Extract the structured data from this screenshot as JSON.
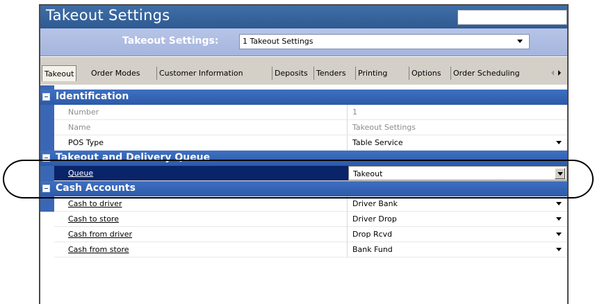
{
  "window": {
    "title": "Takeout Settings"
  },
  "selector": {
    "label": "Takeout Settings:",
    "value": "1 Takeout Settings"
  },
  "tabs": [
    "Takeout",
    "Order Modes",
    "Customer Information",
    "Deposits",
    "Tenders",
    "Printing",
    "Options",
    "Order Scheduling"
  ],
  "sections": {
    "identification": {
      "title": "Identification",
      "rows": [
        {
          "label": "Number",
          "value": "1"
        },
        {
          "label": "Name",
          "value": "Takeout Settings"
        },
        {
          "label": "POS Type",
          "value": "Table Service"
        }
      ]
    },
    "queue": {
      "title": "Takeout and Delivery Queue",
      "rows": [
        {
          "label": "Queue",
          "value": "Takeout"
        }
      ]
    },
    "cash": {
      "title": "Cash Accounts",
      "rows": [
        {
          "label": "Cash to driver",
          "value": "Driver Bank"
        },
        {
          "label": "Cash to store",
          "value": "Driver Drop"
        },
        {
          "label": "Cash from driver",
          "value": "Drop Rcvd"
        },
        {
          "label": "Cash from store",
          "value": "Bank Fund"
        }
      ]
    }
  }
}
